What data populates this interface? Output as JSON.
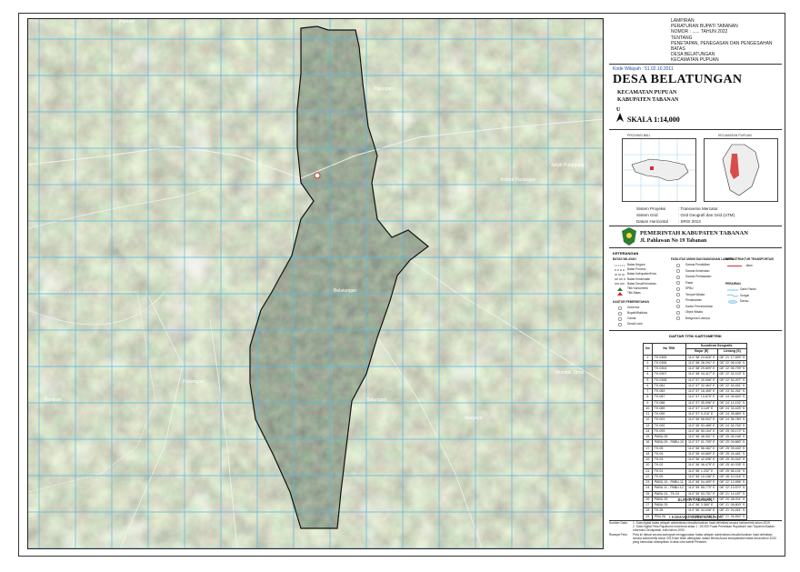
{
  "header": {
    "lines": [
      "LAMPIRAN",
      "PERATURAN BUPATI TABANAN",
      "NOMOR : ...... TAHUN 2022",
      "TENTANG",
      "PENETAPAN, PENEGASAN DAN PENGESAHAN BATAS",
      "DESA BELATUNGAN",
      "KECAMATAN PUPUAN"
    ]
  },
  "kode_wilayah": "Kode Wilayah : 51.02.10.2011",
  "title": "DESA BELATUNGAN",
  "subtitle1": "KECAMATAN PUPUAN",
  "subtitle2": "KABUPATEN TABANAN",
  "north_letter": "U",
  "scale": "SKALA 1:14,000",
  "inset_left_title": "PROVINSI BALI",
  "inset_right_title": "KECAMATAN PUPUAN",
  "projection": [
    {
      "label": "Sistem Proyeksi",
      "value": ": Transverse Mercator"
    },
    {
      "label": "Sistem Grid",
      "value": ": Grid Geografi dan Grid (UTM)"
    },
    {
      "label": "Datum Horizontal",
      "value": ": SRGI 2013"
    }
  ],
  "pemkab": "PEMERINTAH KABUPATEN TABANAN",
  "alamat": "Jl. Pahlawan No 19 Tabanan",
  "keterangan": "KETERANGAN",
  "legend": {
    "batas_title": "BATAS WILAYAH",
    "batas": [
      "Batas Negara",
      "Batas Provinsi",
      "Batas Kabupaten/Kota",
      "Batas Kecamatan",
      "Batas Desa/Kelurahan",
      "Titik Kartometrik",
      "Titik Batas"
    ],
    "fasilitas_title": "FASILITAS UMUM DAN BANGUNAN LAINNYA",
    "fasilitas": [
      "Sarana Pendidikan",
      "Sarana Kesehatan",
      "Sarana Peribadatan",
      "Pasar",
      "SPBU",
      "Tempat Wisata",
      "Pemakaman",
      "Kantor Pemerintahan",
      "Objek Wisata",
      "Bangunan Lainnya"
    ],
    "infra_title": "INFRASTRUKTUR TRANSPORTASI",
    "infra": [
      "Jalan"
    ],
    "perairan_title": "PERAIRAN",
    "perairan": [
      "Garis Pantai",
      "Sungai",
      "Danau"
    ],
    "kantor_title": "KANTOR PEMERINTAHAN",
    "kantor": [
      "Gubernur",
      "Bupati/Walikota",
      "Camat",
      "Desa/Lurah"
    ]
  },
  "table_title": "DAFTAR TITIK KARTOMETRIK",
  "table": {
    "headers": [
      "No",
      "No TBK",
      "Koordinat Geografis",
      "Bujur (E)",
      "Lintang (S)"
    ],
    "rows": [
      [
        "1",
        "TK.0305",
        "114° 58' 24.626\" E",
        "08° 21' 17.659\" S"
      ],
      [
        "2",
        "TK.0306",
        "114° 58' 28.291\" E",
        "08° 22' 08.106\" S"
      ],
      [
        "3",
        "TK.0304",
        "114° 58' 29.699\" E",
        "08° 22' 06.799\" S"
      ],
      [
        "4",
        "TK.0307",
        "114° 58' 34.417\" E",
        "08° 22' 32.103\" S"
      ],
      [
        "5",
        "TK.0308",
        "114° 57' 30.596\" E",
        "08° 22' 54.207\" S"
      ],
      [
        "6",
        "TK.081",
        "114° 57' 32.464\" E",
        "08° 22' 54.451\" S"
      ],
      [
        "7",
        "TK.083",
        "114° 57' 16.455\" E",
        "08° 23' 51.261\" S"
      ],
      [
        "8",
        "TK.087",
        "114° 57' 13.875\" E",
        "08° 24' 05.640\" S"
      ],
      [
        "9",
        "TK.088",
        "114° 57' 05.096\" E",
        "08° 24' 14.152\" S"
      ],
      [
        "10",
        "TK.089",
        "114° 57' 3.149\" E",
        "08° 24' 33.425\" S"
      ],
      [
        "11",
        "TK.090",
        "114° 57' 0.216\" E",
        "08° 24' 35.889\" S"
      ],
      [
        "12",
        "TK.091",
        "114° 56' 58.502\" E",
        "08° 24' 36.780\" S"
      ],
      [
        "13",
        "TK.092",
        "114° 56' 53.488\" E",
        "08° 24' 54.754\" S"
      ],
      [
        "14",
        "TK.093",
        "114° 56' 50.154\" E",
        "08° 25' 05.172\" S"
      ],
      [
        "15",
        "PABU.09",
        "114° 56' 48.901\" E",
        "08° 25' 06.168\" S"
      ],
      [
        "16",
        "PABU.09 - PABU.10",
        "114° 57' 01.795\" E",
        "08° 25' 09.880\" S"
      ],
      [
        "17",
        "TK.05",
        "114° 56' 56.382\" E",
        "08° 25' 09.440\" S"
      ],
      [
        "18",
        "TK.04",
        "114° 56' 44.669\" E",
        "08° 25' 24.481\" S"
      ],
      [
        "19",
        "TK.03",
        "114° 56' 42.096\" E",
        "08° 25' 30.042\" S"
      ],
      [
        "20",
        "TK.02",
        "114° 56' 36.475\" E",
        "08° 25' 40.335\" S"
      ],
      [
        "21",
        "TK.01",
        "114° 56' 1.232\" E",
        "08° 25' 56.191\" S"
      ],
      [
        "22",
        "TK.00",
        "114° 56' 10.158\" E",
        "08° 26' 10.016\" S"
      ],
      [
        "23",
        "PABU.10 - PABU.11",
        "114° 56' 04.499\" E",
        "08° 22' 12.896\" S"
      ],
      [
        "24",
        "PABU.11 - PABU.12",
        "114° 55' 55.779\" E",
        "08° 22' 13.570\" S"
      ],
      [
        "25",
        "PABU.24 - TK.24",
        "114° 55' 53.751\" E",
        "08° 21' 14.187\" S"
      ],
      [
        "26",
        "PABU.25",
        "114° 55' 45.180\" E",
        "08° 20' 48.001\" S"
      ],
      [
        "27",
        "PABU.25",
        "114° 56' 3.365\" E",
        "08° 21' 06.800\" S"
      ],
      [
        "28",
        "TK.26",
        "114° 56' 34.046\" E",
        "08° 21' 24.451\" S"
      ],
      [
        "29",
        "PBU.26",
        "114° 56' 43.726\" E",
        "08° 21' 26.892\" S"
      ]
    ]
  },
  "sign_title": "BUPATI TABANAN,",
  "sign_name": "I KOMANG GEDE SANJAYA",
  "notes": [
    {
      "k": "Sumber Data :",
      "v": "1. Data digital batas wilayah administrasi desa/kelurahan hasil delimitasi secara kartometrik tahun 2019."
    },
    {
      "k": "",
      "v": "2. Data Digital Peta Rupabumi Indonesia skala 1 : 25.000 Pusat Pemetaan Rupabumi dan Toponimi Badan Informasi Geospasial, edisi tahun 2000"
    },
    {
      "k": "Riwayat Peta :",
      "v": "Peta ini dibuat secara kartografi menggunakan batas wilayah administrasi desa/kelurahan hasil delimitasi secara kartometrik tahun 2019 dan telah ditetapkan dalam Berita Acara kesepakatan batas desa tahun 2022 yang kemudian ditampilkan di atas citra satelit Pleiades."
    }
  ],
  "map": {
    "places": [
      "Belatungan",
      "Pujungan",
      "Pupuan",
      "Kebon Padangan",
      "Jelijih Punggang",
      "Batungsel",
      "Munduk Temu",
      "Margaya",
      "Padangan",
      "Bantiran"
    ],
    "colors": {
      "grid": "#56b8e6",
      "boundary": "#111111",
      "road": "#f2f2f2"
    }
  }
}
